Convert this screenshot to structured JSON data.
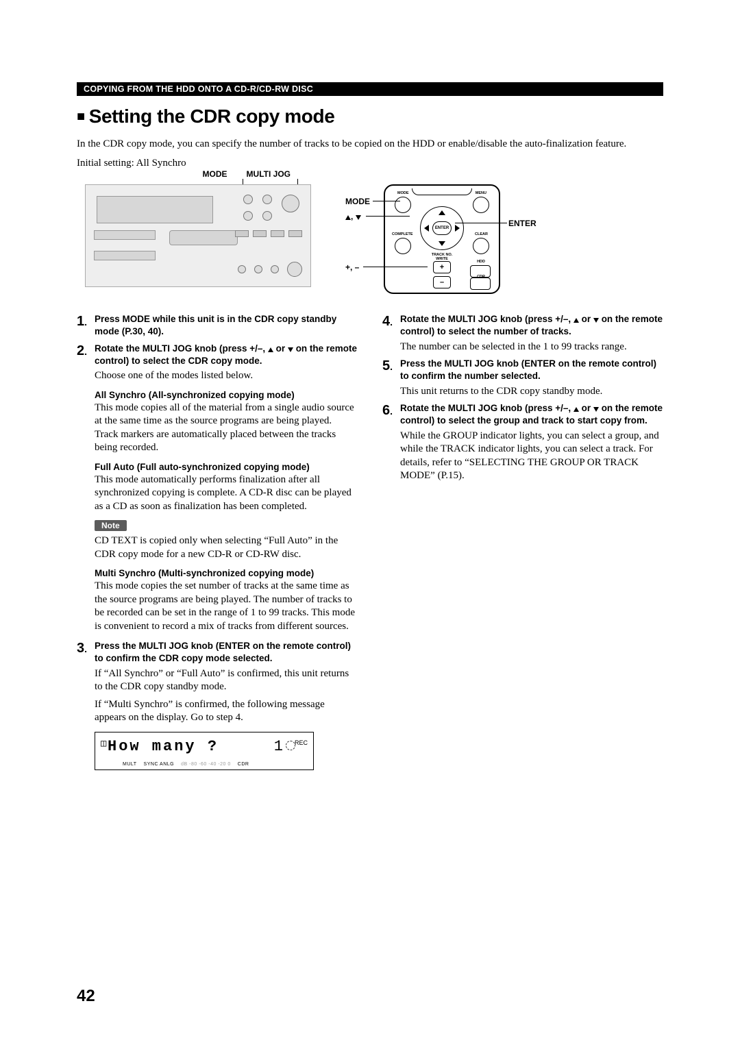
{
  "header_bar": "COPYING FROM THE HDD ONTO A CD-R/CD-RW DISC",
  "section_title": "Setting the CDR copy mode",
  "intro": "In the CDR copy mode, you can specify the number of tracks to be copied on the HDD or enable/disable the auto-finalization feature.",
  "initial_setting": "Initial setting: All Synchro",
  "device_labels": {
    "mode": "MODE",
    "multijog": "MULTI JOG"
  },
  "remote_labels": {
    "mode": "MODE",
    "arrows": "▲, ▼",
    "plusminus": "+, –",
    "enter": "ENTER",
    "btn_mode": "MODE",
    "btn_menu": "MENU",
    "btn_center": "ENTER",
    "btn_complete": "COMPLETE",
    "btn_clear": "CLEAR",
    "btn_track": "TRACK NO.\nWRITE",
    "btn_hdd": "HDD",
    "btn_cdr": "CDR"
  },
  "steps": {
    "s1": "Press MODE while this unit is in the CDR copy standby mode (P.30, 40).",
    "s2": "Rotate the MULTI JOG knob (press +/–, ▲ or ▼ on the remote control) to select the CDR copy mode.",
    "s2_sub": "Choose one of the modes listed below.",
    "allsync_h": "All Synchro (All-synchronized copying mode)",
    "allsync_b": "This mode copies all of the material from a single audio source at the same time as the source programs are being played. Track markers are automatically placed between the tracks being recorded.",
    "fullauto_h": "Full Auto (Full auto-synchronized copying mode)",
    "fullauto_b": "This mode automatically performs finalization after all synchronized copying is complete. A CD-R disc can be played as a CD as soon as finalization has been completed.",
    "note_label": "Note",
    "note_body": "CD TEXT is copied only when selecting “Full Auto” in the CDR copy mode for a new CD-R or CD-RW disc.",
    "multisync_h": "Multi Synchro (Multi-synchronized copying mode)",
    "multisync_b": "This mode copies the set number of tracks at the same time as the source programs are being played. The number of tracks to be recorded can be set in the range of 1 to 99 tracks. This mode is convenient to record a mix of tracks from different sources.",
    "s3": "Press the MULTI JOG knob (ENTER on the remote control) to confirm the CDR copy mode selected.",
    "s3_sub1": "If “All Synchro” or “Full Auto” is confirmed, this unit returns to the CDR copy standby mode.",
    "s3_sub2": "If “Multi Synchro” is confirmed, the following message appears on the display. Go to step 4.",
    "s4": "Rotate the MULTI JOG knob (press +/–, ▲ or ▼ on the remote control) to select the number of tracks.",
    "s4_sub": "The number can be selected in the 1 to 99 tracks range.",
    "s5": "Press the MULTI JOG knob (ENTER on the remote control) to confirm the number selected.",
    "s5_sub": "This unit returns to the CDR copy standby mode.",
    "s6": "Rotate the MULTI JOG knob (press +/–, ▲ or ▼ on the remote control) to select the group and track to start copy from.",
    "s6_sub": "While the GROUP indicator lights, you can select a group, and while the TRACK indicator lights, you can select a track. For details, refer to “SELECTING THE GROUP OR TRACK MODE” (P.15)."
  },
  "display": {
    "main": "How many ?",
    "num": "1",
    "rec": "REC",
    "bottom": {
      "a": "MULT",
      "b": "SYNC ANLG",
      "c": "dB  -80 -60 -40 -20  0",
      "d": "CDR"
    }
  },
  "page_number": "42"
}
